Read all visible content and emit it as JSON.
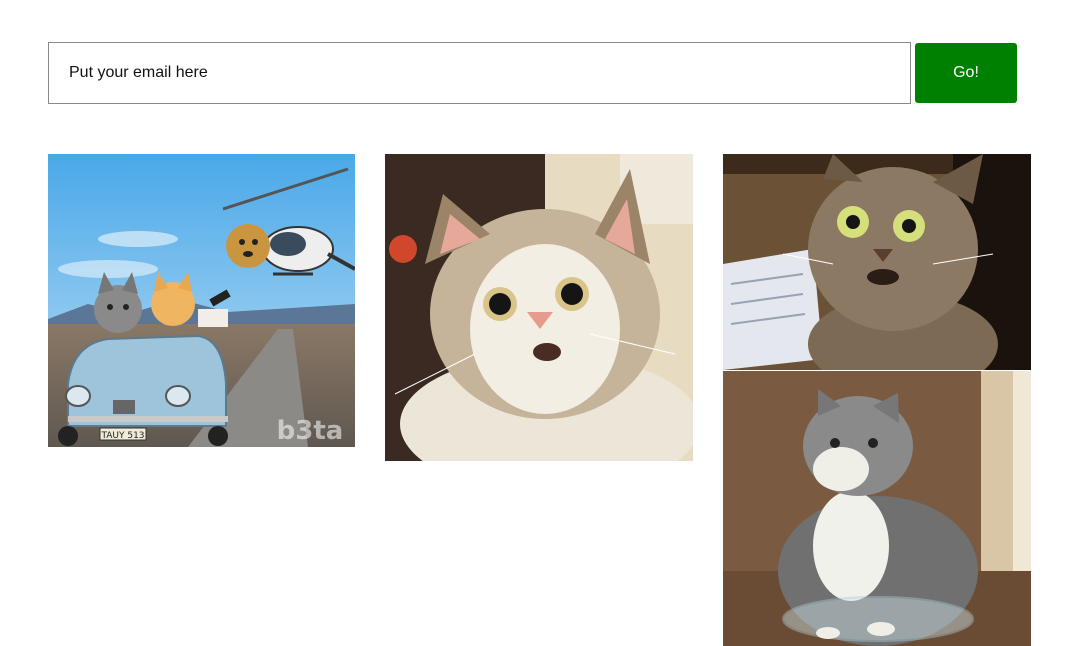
{
  "email_form": {
    "placeholder": "Put your email here",
    "button_label": "Go!"
  },
  "gifs": [
    {
      "description": "Cats driving a blue convertible chased by a dog flying a helicopter",
      "plate_text": "TAUY 513",
      "watermark": "b3ta"
    },
    {
      "description": "Shocked cat with wide eyes"
    },
    {
      "description": "Surprised tabby cat next to papers"
    },
    {
      "description": "Fat cat sitting in a glass bowl"
    }
  ],
  "colors": {
    "go_button": "#008000",
    "input_border": "#8a8a8a"
  }
}
